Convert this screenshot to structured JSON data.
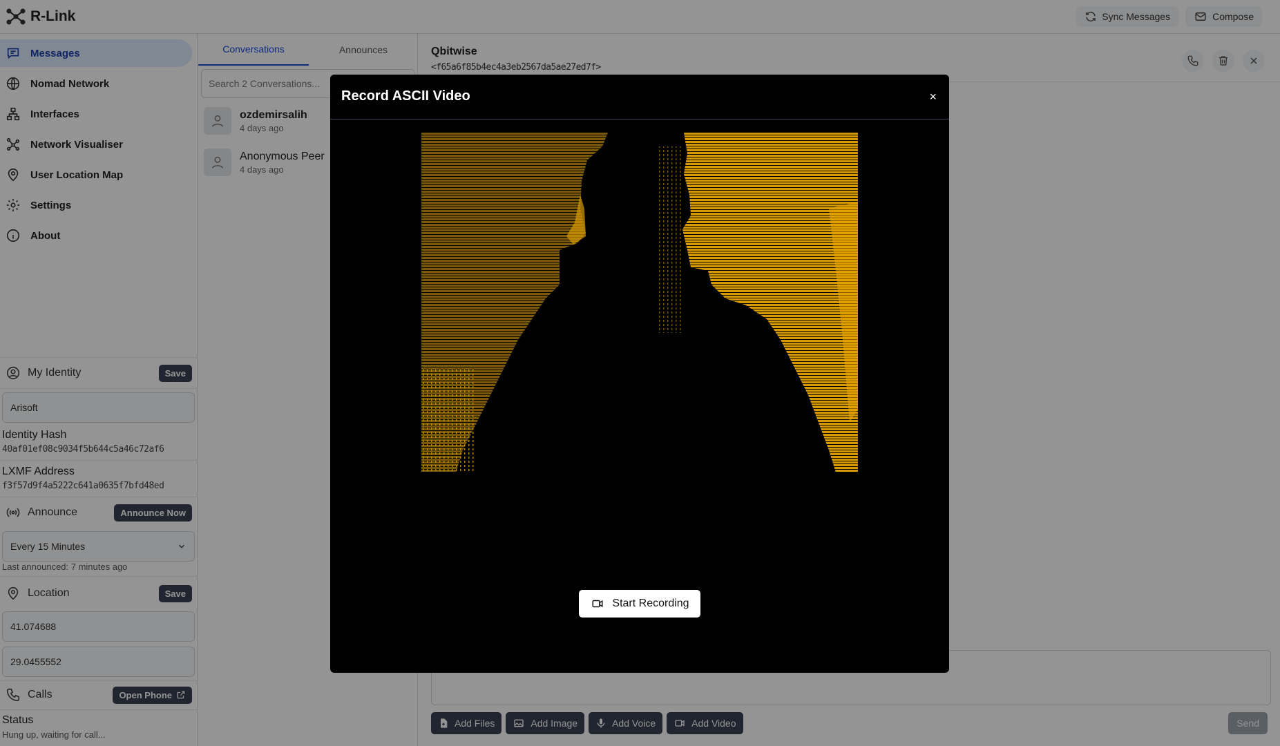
{
  "app": {
    "name": "R-Link"
  },
  "header": {
    "sync_label": "Sync Messages",
    "compose_label": "Compose"
  },
  "nav": [
    {
      "label": "Messages",
      "icon": "chat-icon",
      "active": true
    },
    {
      "label": "Nomad Network",
      "icon": "globe-icon"
    },
    {
      "label": "Interfaces",
      "icon": "network-icon"
    },
    {
      "label": "Network Visualiser",
      "icon": "graph-icon"
    },
    {
      "label": "User Location Map",
      "icon": "map-pin-icon"
    },
    {
      "label": "Settings",
      "icon": "gear-icon"
    },
    {
      "label": "About",
      "icon": "info-icon"
    }
  ],
  "identity": {
    "title": "My Identity",
    "save_label": "Save",
    "name": "Arisoft",
    "hash_label": "Identity Hash",
    "hash": "40af01ef08c9034f5b644c5a46c72af6",
    "lxmf_label": "LXMF Address",
    "lxmf": "f3f57d9f4a5222c641a0635f7bfd48ed"
  },
  "announce": {
    "title": "Announce",
    "button_label": "Announce Now",
    "interval": "Every 15 Minutes",
    "last": "Last announced: 7 minutes ago"
  },
  "location": {
    "title": "Location",
    "save_label": "Save",
    "lat": "41.074688",
    "lon": "29.0455552"
  },
  "calls": {
    "title": "Calls",
    "button_label": "Open Phone",
    "status_label": "Status",
    "status": "Hung up, waiting for call..."
  },
  "conversations": {
    "tabs": [
      "Conversations",
      "Announces"
    ],
    "search_placeholder": "Search 2 Conversations...",
    "items": [
      {
        "name": "ozdemirsalih",
        "time": "4 days ago",
        "bold": true
      },
      {
        "name": "Anonymous Peer",
        "time": "4 days ago",
        "bold": false
      }
    ]
  },
  "chat": {
    "title": "Qbitwise",
    "hash": "<f65a6f85b4ec4a3eb2567da5ae27ed7f>",
    "attach": [
      "Add Files",
      "Add Image",
      "Add Voice",
      "Add Video"
    ],
    "send_label": "Send"
  },
  "modal": {
    "title": "Record ASCII Video",
    "close": "×",
    "record_label": "Start Recording"
  },
  "colors": {
    "accent": "#1d4ed8",
    "ascii_amber": "#e8a400",
    "dark_button": "#374151"
  }
}
